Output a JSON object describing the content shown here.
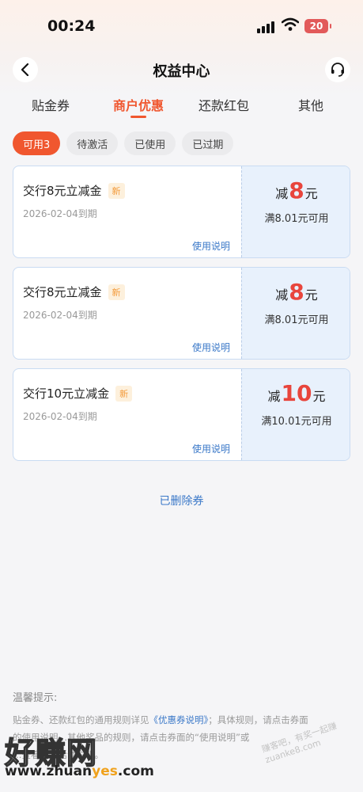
{
  "status_bar": {
    "time": "00:24",
    "battery": "20",
    "icons": [
      "signal-icon",
      "wifi-icon",
      "battery-icon"
    ]
  },
  "nav": {
    "title": "权益中心",
    "back_icon": "chevron-left-icon",
    "service_icon": "headset-icon"
  },
  "tabs": [
    {
      "label": "贴金券",
      "active": false
    },
    {
      "label": "商户优惠",
      "active": true
    },
    {
      "label": "还款红包",
      "active": false
    },
    {
      "label": "其他",
      "active": false
    }
  ],
  "filters": [
    {
      "label": "可用3",
      "active": true
    },
    {
      "label": "待激活",
      "active": false
    },
    {
      "label": "已使用",
      "active": false
    },
    {
      "label": "已过期",
      "active": false
    }
  ],
  "coupons": [
    {
      "title": "交行8元立减金",
      "badge": "新",
      "expire": "2026-02-04到期",
      "link": "使用说明",
      "amount_prefix": "减",
      "amount": "8",
      "amount_unit": "元",
      "condition": "满8.01元可用"
    },
    {
      "title": "交行8元立减金",
      "badge": "新",
      "expire": "2026-02-04到期",
      "link": "使用说明",
      "amount_prefix": "减",
      "amount": "8",
      "amount_unit": "元",
      "condition": "满8.01元可用"
    },
    {
      "title": "交行10元立减金",
      "badge": "新",
      "expire": "2026-02-04到期",
      "link": "使用说明",
      "amount_prefix": "减",
      "amount": "10",
      "amount_unit": "元",
      "condition": "满10.01元可用"
    }
  ],
  "deleted_link": "已删除券",
  "tips": {
    "title": "温馨提示:",
    "line1_a": "贴金券、还款红包的通用规则详见",
    "line1_link": "《优惠券说明》",
    "line1_b": "；具体规则，请点击券面",
    "line2": "的使用说明…其他奖品的规则，请点击券面的“使用说明”或",
    "line3": "…查看相关活动说明。"
  },
  "watermark": {
    "brand": "好赚网",
    "url_a": "www.zhuan",
    "url_b": "yes",
    "url_c": ".com",
    "stamp": "赚客吧，有奖一起赚 zuanke8.com"
  },
  "colors": {
    "accent": "#f0572f",
    "amount_red": "#e8453c",
    "link_blue": "#3a78c8",
    "coupon_right_bg": "#e8f1fc"
  }
}
